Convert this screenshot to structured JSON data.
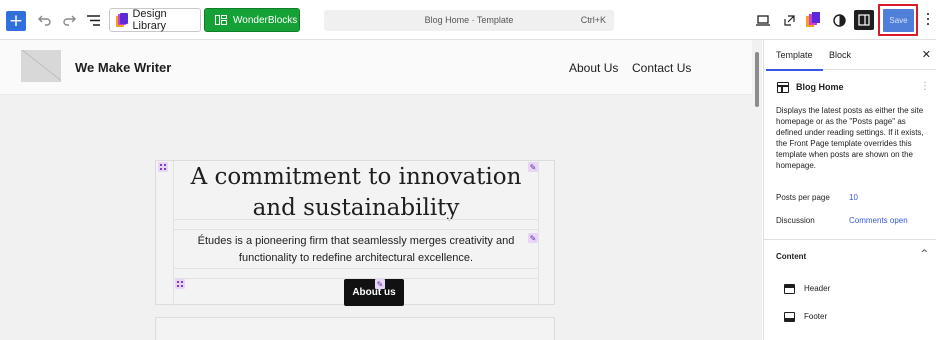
{
  "toolbar": {
    "design_library_label": "Design Library",
    "wonderblocks_label": "WonderBlocks",
    "command_title": "Blog Home · Template",
    "command_shortcut": "Ctrl+K",
    "save_label": "Save"
  },
  "site": {
    "title": "We Make Writer",
    "nav": [
      "About Us",
      "Contact Us"
    ]
  },
  "hero": {
    "heading_line1": "A commitment to innovation",
    "heading_line2": "and sustainability",
    "paragraph_line1": "Études is a pioneering firm that seamlessly merges creativity and",
    "paragraph_line2": "functionality to redefine architectural excellence.",
    "button_label": "About us"
  },
  "sidebar": {
    "tabs": [
      "Template",
      "Block"
    ],
    "template_name": "Blog Home",
    "description": "Displays the latest posts as either the site homepage or as the \"Posts page\" as defined under reading settings. If it exists, the Front Page template overrides this template when posts are shown on the homepage.",
    "posts_per_page_label": "Posts per page",
    "posts_per_page_value": "10",
    "discussion_label": "Discussion",
    "discussion_value": "Comments open",
    "content_title": "Content",
    "parts": [
      "Header",
      "Footer"
    ]
  },
  "colors": {
    "accent": "#3858e9",
    "save_highlight": "#d7192a",
    "wonderblocks_green": "#15a135"
  }
}
